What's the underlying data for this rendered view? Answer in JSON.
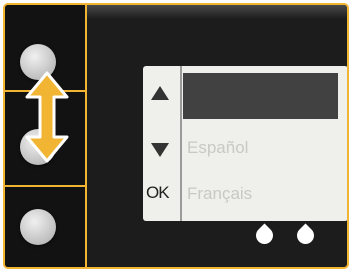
{
  "device": {
    "accent_color": "#f2b533",
    "buttons": [
      {
        "name": "top-button"
      },
      {
        "name": "middle-button"
      },
      {
        "name": "bottom-button"
      }
    ],
    "navigation_hint_icon": "up-down-arrow-icon"
  },
  "lcd": {
    "up_icon": "up-arrow-icon",
    "down_icon": "down-arrow-icon",
    "ok_label": "OK",
    "selected_item": "",
    "languages": [
      "Español",
      "Français"
    ]
  },
  "ink_icons": [
    "ink-drop-icon",
    "ink-drop-icon"
  ]
}
